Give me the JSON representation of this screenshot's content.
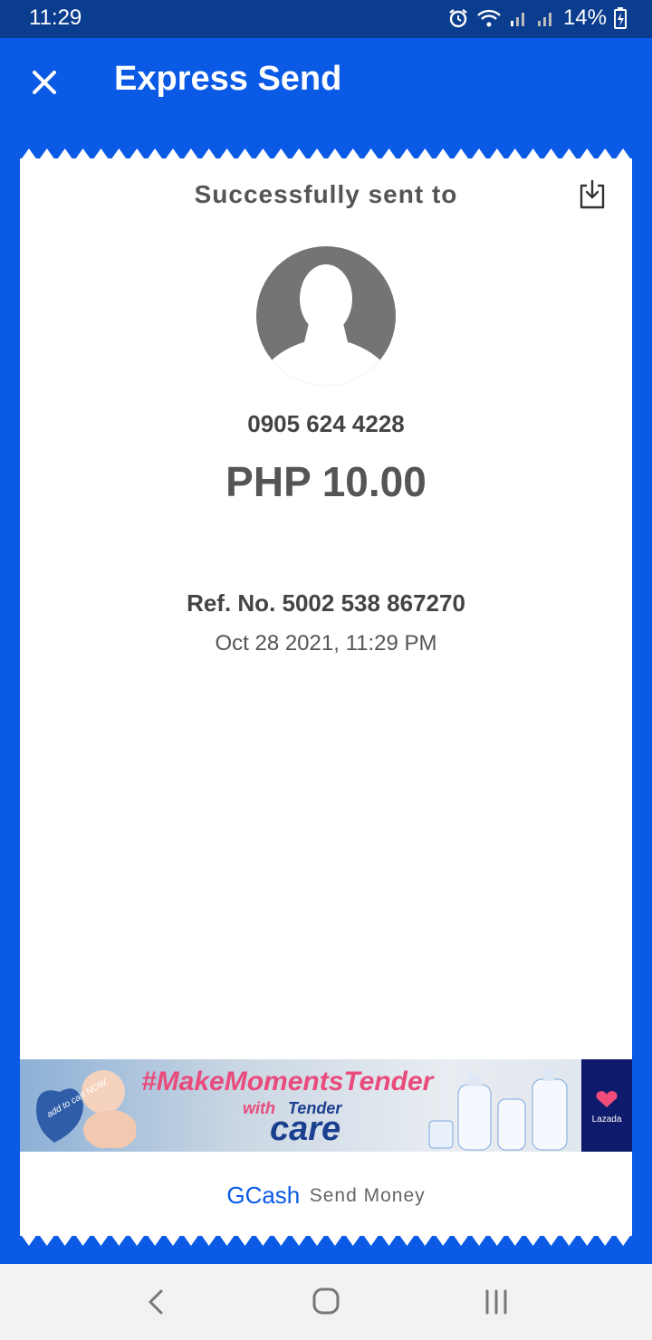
{
  "status_bar": {
    "time": "11:29",
    "battery": "14%",
    "icons": [
      "alarm-icon",
      "wifi-icon",
      "signal-icon",
      "signal-icon",
      "battery-charging-icon"
    ]
  },
  "header": {
    "title": "Express Send",
    "close_icon": "close-icon"
  },
  "receipt": {
    "heading": "Successfully sent to",
    "download_icon": "download-icon",
    "avatar_icon": "default-avatar-icon",
    "recipient_number": "0905 624 4228",
    "amount": "PHP 10.00",
    "reference": "Ref. No. 5002 538 867270",
    "datetime": "Oct 28 2021, 11:29 PM"
  },
  "ad_banner": {
    "hashtag": "#MakeMomentsTender",
    "with_text": "with",
    "brand_top": "Tender",
    "brand_main": "care",
    "badge_text": "add to cart NOW",
    "partner": "Lazada"
  },
  "footer": {
    "brand": "GCash",
    "service": "Send Money"
  },
  "nav_bar": {
    "icons": [
      "back-icon",
      "home-icon",
      "recents-icon"
    ]
  },
  "colors": {
    "primary": "#0a5ae6",
    "status_bar": "#0b3d8f",
    "text_dark": "#555555"
  }
}
